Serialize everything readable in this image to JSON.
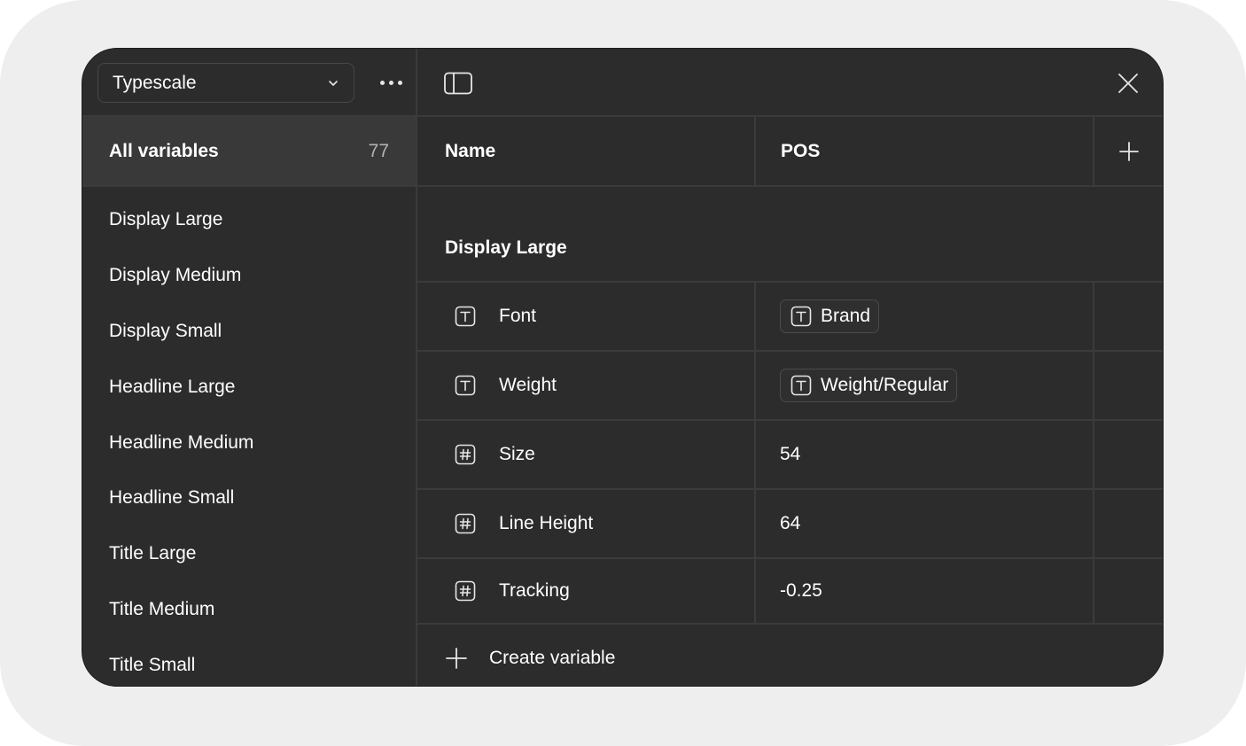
{
  "collection": {
    "selected": "Typescale"
  },
  "sidebar": {
    "all_variables": {
      "label": "All variables",
      "count": "77"
    },
    "groups": [
      "Display Large",
      "Display Medium",
      "Display Small",
      "Headline Large",
      "Headline Medium",
      "Headline Small",
      "Title Large",
      "Title Medium",
      "Title Small"
    ]
  },
  "table": {
    "columns": {
      "name": "Name",
      "mode": "POS"
    },
    "group_title": "Display Large",
    "rows": [
      {
        "name": "Font",
        "type_icon": "text-type-icon",
        "value": "Brand",
        "value_kind": "alias"
      },
      {
        "name": "Weight",
        "type_icon": "text-type-icon",
        "value": "Weight/Regular",
        "value_kind": "alias"
      },
      {
        "name": "Size",
        "type_icon": "number-type-icon",
        "value": "54",
        "value_kind": "plain"
      },
      {
        "name": "Line Height",
        "type_icon": "number-type-icon",
        "value": "64",
        "value_kind": "plain"
      },
      {
        "name": "Tracking",
        "type_icon": "number-type-icon",
        "value": "-0.25",
        "value_kind": "plain"
      }
    ],
    "create_label": "Create variable"
  },
  "colors": {
    "panel_bg": "#2c2c2c",
    "selected_bg": "#393939",
    "divider": "#3b3b3b",
    "outer_bg": "#eeeeee"
  }
}
